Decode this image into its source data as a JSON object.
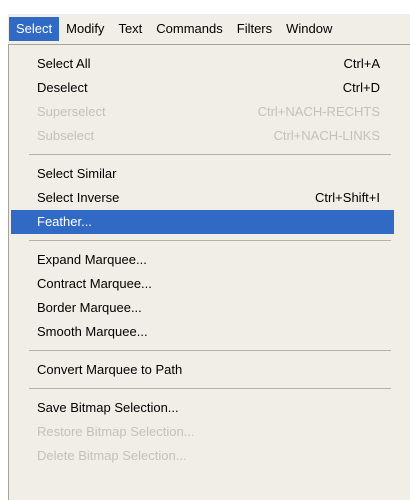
{
  "menubar": {
    "items": [
      {
        "label": "Select"
      },
      {
        "label": "Modify"
      },
      {
        "label": "Text"
      },
      {
        "label": "Commands"
      },
      {
        "label": "Filters"
      },
      {
        "label": "Window"
      }
    ]
  },
  "menu": {
    "groups": [
      [
        {
          "label": "Select All",
          "shortcut": "Ctrl+A",
          "enabled": true
        },
        {
          "label": "Deselect",
          "shortcut": "Ctrl+D",
          "enabled": true
        },
        {
          "label": "Superselect",
          "shortcut": "Ctrl+NACH-RECHTS",
          "enabled": false
        },
        {
          "label": "Subselect",
          "shortcut": "Ctrl+NACH-LINKS",
          "enabled": false
        }
      ],
      [
        {
          "label": "Select Similar",
          "shortcut": "",
          "enabled": true
        },
        {
          "label": "Select Inverse",
          "shortcut": "Ctrl+Shift+I",
          "enabled": true
        },
        {
          "label": "Feather...",
          "shortcut": "",
          "enabled": true,
          "highlighted": true
        }
      ],
      [
        {
          "label": "Expand Marquee...",
          "shortcut": "",
          "enabled": true
        },
        {
          "label": "Contract Marquee...",
          "shortcut": "",
          "enabled": true
        },
        {
          "label": "Border Marquee...",
          "shortcut": "",
          "enabled": true
        },
        {
          "label": "Smooth Marquee...",
          "shortcut": "",
          "enabled": true
        }
      ],
      [
        {
          "label": "Convert Marquee to Path",
          "shortcut": "",
          "enabled": true
        }
      ],
      [
        {
          "label": "Save Bitmap Selection...",
          "shortcut": "",
          "enabled": true
        },
        {
          "label": "Restore Bitmap Selection...",
          "shortcut": "",
          "enabled": false
        },
        {
          "label": "Delete Bitmap Selection...",
          "shortcut": "",
          "enabled": false
        }
      ]
    ]
  },
  "colors": {
    "highlight": "#316ac5",
    "menu_background": "#f0eee6",
    "disabled_text": "#c3c1b8"
  }
}
